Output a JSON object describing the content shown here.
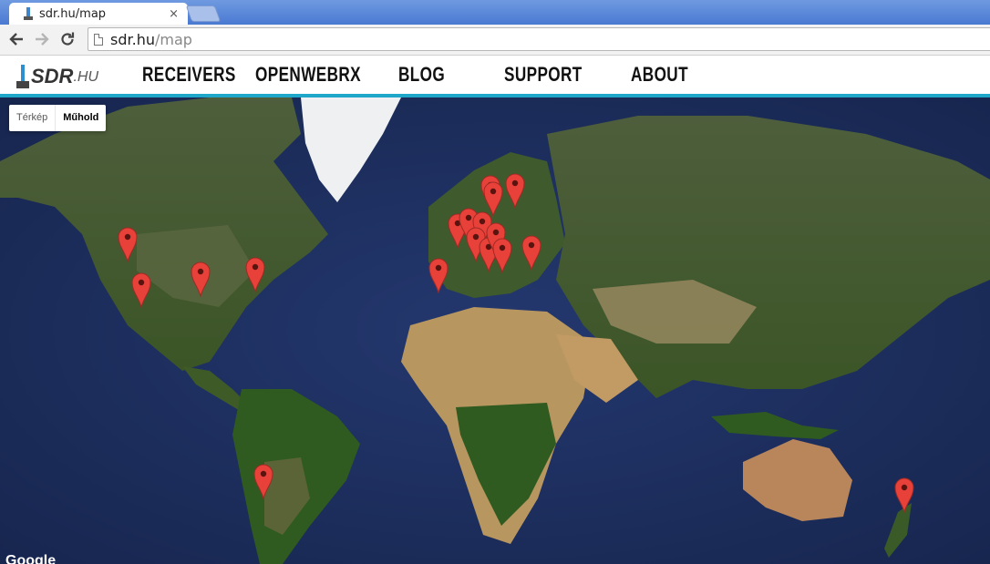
{
  "browser": {
    "tab_title": "sdr.hu/map",
    "tab_close": "×",
    "url_host": "sdr.hu",
    "url_path": "/map"
  },
  "site": {
    "logo_text": "SDR",
    "logo_suffix": ".HU",
    "nav": [
      "RECEIVERS",
      "OPENWEBRX",
      "BLOG",
      "SUPPORT",
      "ABOUT"
    ]
  },
  "map": {
    "type_map_label": "Térkép",
    "type_satellite_label": "Műhold",
    "selected_type": "Műhold",
    "attribution": "Google",
    "marker_color": "#e8413a",
    "ocean_color": "#1d2f63"
  }
}
